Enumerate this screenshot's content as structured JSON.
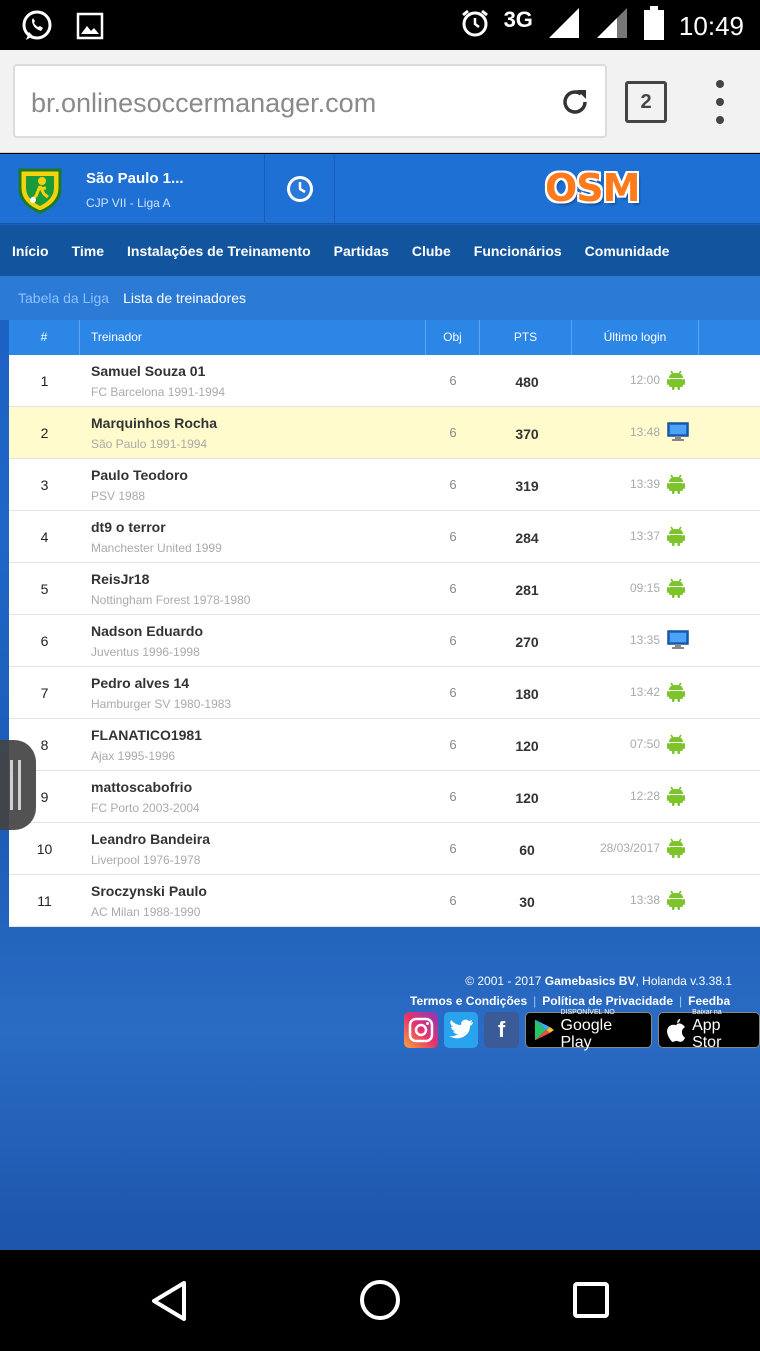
{
  "status_bar": {
    "network": "3G",
    "time": "10:49"
  },
  "browser": {
    "url": "br.onlinesoccermanager.com",
    "tab_count": "2"
  },
  "club": {
    "name": "São Paulo 1...",
    "league": "CJP VII - Liga A"
  },
  "logo": {
    "text": "OSM"
  },
  "nav": {
    "items": [
      "Início",
      "Time",
      "Instalações de Treinamento",
      "Partidas",
      "Clube",
      "Funcionários",
      "Comunidade"
    ]
  },
  "subnav": {
    "tab_league": "Tabela da Liga",
    "tab_managers": "Lista de treinadores"
  },
  "table": {
    "headers": {
      "num": "#",
      "manager": "Treinador",
      "obj": "Obj",
      "pts": "PTS",
      "last_login": "Último login"
    },
    "rows": [
      {
        "num": "1",
        "name": "Samuel Souza 01",
        "club": "FC Barcelona 1991-1994",
        "obj": "6",
        "pts": "480",
        "login": "12:00",
        "device": "android-icon",
        "highlight": false
      },
      {
        "num": "2",
        "name": "Marquinhos Rocha",
        "club": "São Paulo 1991-1994",
        "obj": "6",
        "pts": "370",
        "login": "13:48",
        "device": "desktop-icon",
        "highlight": true
      },
      {
        "num": "3",
        "name": "Paulo Teodoro",
        "club": "PSV 1988",
        "obj": "6",
        "pts": "319",
        "login": "13:39",
        "device": "android-icon",
        "highlight": false
      },
      {
        "num": "4",
        "name": "dt9 o terror",
        "club": "Manchester United 1999",
        "obj": "6",
        "pts": "284",
        "login": "13:37",
        "device": "android-icon",
        "highlight": false
      },
      {
        "num": "5",
        "name": "ReisJr18",
        "club": "Nottingham Forest 1978-1980",
        "obj": "6",
        "pts": "281",
        "login": "09:15",
        "device": "android-icon",
        "highlight": false
      },
      {
        "num": "6",
        "name": "Nadson Eduardo",
        "club": "Juventus 1996-1998",
        "obj": "6",
        "pts": "270",
        "login": "13:35",
        "device": "desktop-icon",
        "highlight": false
      },
      {
        "num": "7",
        "name": "Pedro alves 14",
        "club": "Hamburger SV 1980-1983",
        "obj": "6",
        "pts": "180",
        "login": "13:42",
        "device": "android-icon",
        "highlight": false
      },
      {
        "num": "8",
        "name": "FLANATICO1981",
        "club": "Ajax 1995-1996",
        "obj": "6",
        "pts": "120",
        "login": "07:50",
        "device": "android-icon",
        "highlight": false
      },
      {
        "num": "9",
        "name": "mattoscabofrio",
        "club": "FC Porto 2003-2004",
        "obj": "6",
        "pts": "120",
        "login": "12:28",
        "device": "android-icon",
        "highlight": false
      },
      {
        "num": "10",
        "name": "Leandro Bandeira",
        "club": "Liverpool 1976-1978",
        "obj": "6",
        "pts": "60",
        "login": "28/03/2017",
        "device": "android-icon",
        "highlight": false
      },
      {
        "num": "11",
        "name": "Sroczynski Paulo",
        "club": "AC Milan 1988-1990",
        "obj": "6",
        "pts": "30",
        "login": "13:38",
        "device": "android-icon",
        "highlight": false
      }
    ]
  },
  "footer": {
    "copyright_prefix": "© 2001 - 2017 ",
    "company": "Gamebasics BV",
    "copyright_suffix": ", Holanda v.3.38.1",
    "link_terms": "Termos e Condições",
    "link_privacy": "Política de Privacidade",
    "link_feedback": "Feedba",
    "google_small": "DISPONÍVEL NO",
    "google_big": "Google Play",
    "apple_small": "Baixar na",
    "apple_big": "App Stor"
  },
  "colors": {
    "brand_blue": "#1f70d4",
    "nav_blue": "#13549f",
    "header_blue": "#2b86e6",
    "highlight_row": "#fffbcc",
    "android_green": "#7cc42a",
    "osm_orange": "#ff7a1a"
  }
}
